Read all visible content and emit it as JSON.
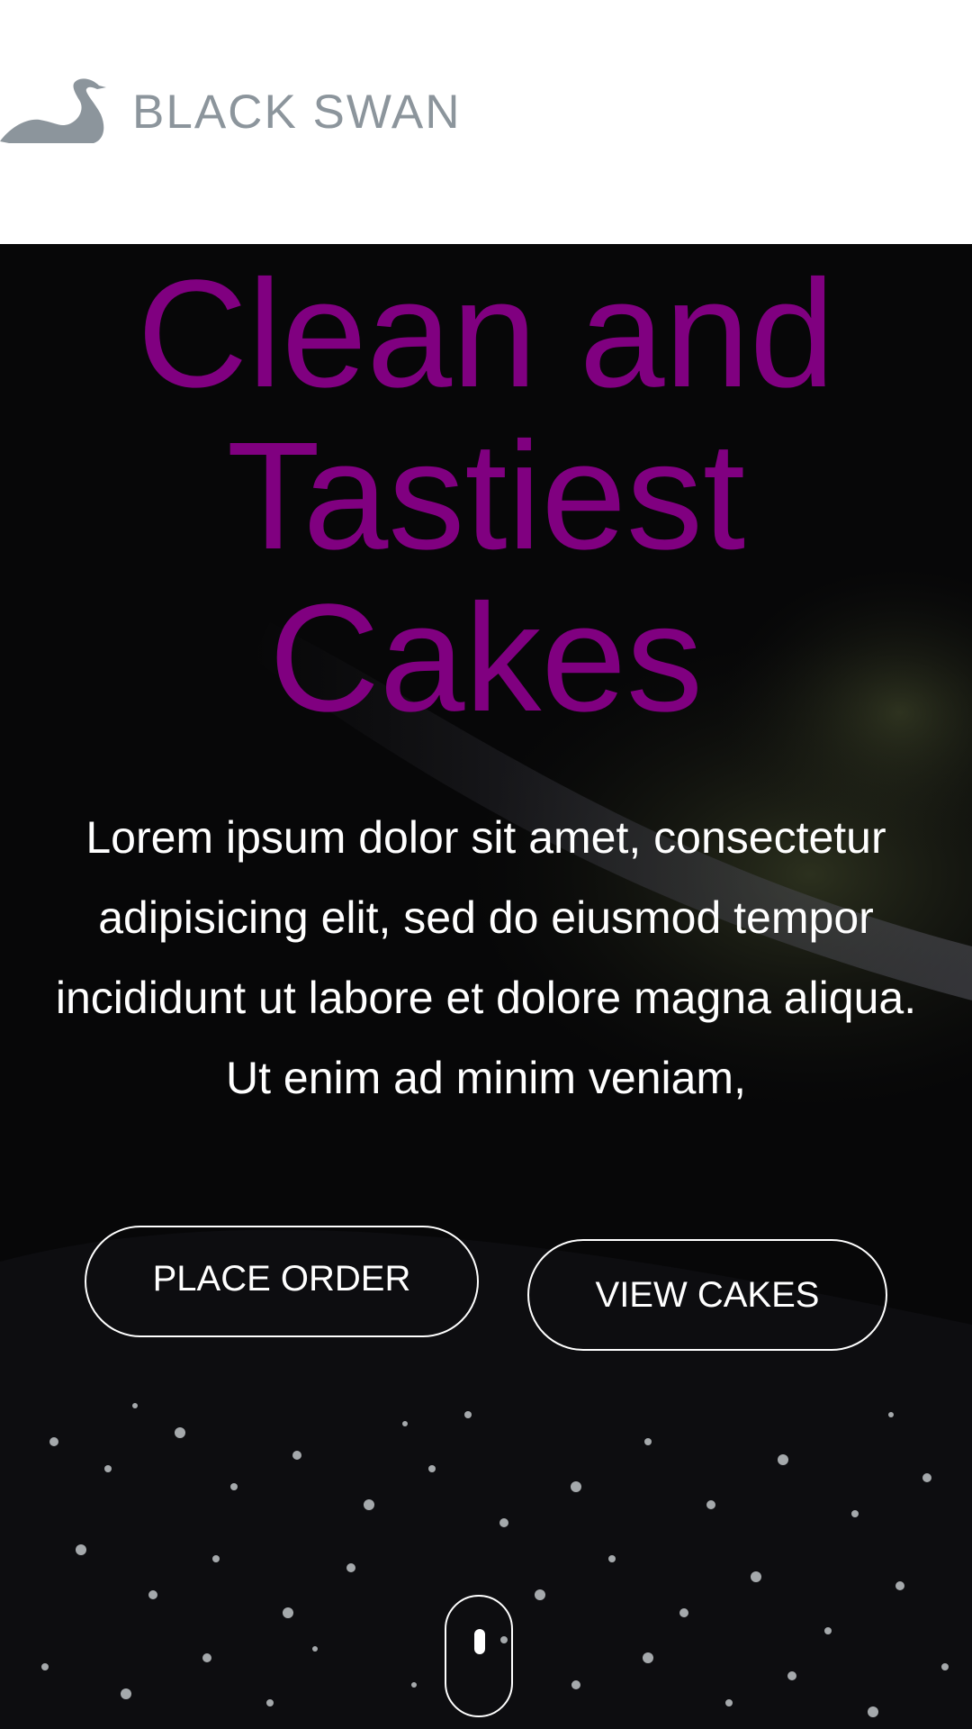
{
  "header": {
    "logo_text": "BLACK SWAN",
    "logo_icon": "swan-icon"
  },
  "hero": {
    "headline": "Clean and\nTastiest\nCakes",
    "paragraph": "Lorem ipsum dolor sit amet, consectetur adipisicing elit, sed do eiusmod tempor incididunt ut labore et dolore magna aliqua. Ut enim ad minim veniam,",
    "place_order_label": "PLACE ORDER",
    "view_cakes_label": "VIEW CAKES",
    "scroll_icon": "mouse-scroll-icon"
  },
  "colors": {
    "headline": "#800080",
    "logo": "#8c959c",
    "hero_background": "#070708",
    "text": "#ffffff"
  }
}
